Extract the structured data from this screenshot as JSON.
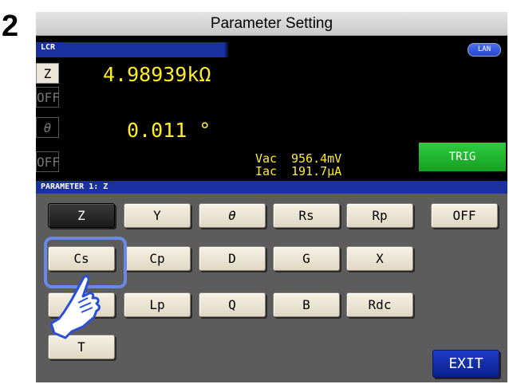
{
  "step_number": "2",
  "title": "Parameter Setting",
  "lcr_label": "LCR",
  "lan_label": "LAN",
  "rows": [
    {
      "param": "Z",
      "value": "4.98939kΩ"
    },
    {
      "param": "OFF"
    },
    {
      "param": "θ",
      "value": "0.011 °"
    },
    {
      "param": "OFF"
    }
  ],
  "monitor": {
    "vac_label": "Vac",
    "vac_value": "956.4mV",
    "iac_label": "Iac",
    "iac_value": "191.7μA"
  },
  "trig_label": "TRIG",
  "param_bar": "PARAMETER 1:  Z",
  "keys": {
    "row1": [
      "Z",
      "Y",
      "θ",
      "Rs",
      "Rp",
      "OFF"
    ],
    "row2": [
      "Cs",
      "Cp",
      "D",
      "G",
      "X"
    ],
    "row3": [
      "Lp",
      "Q",
      "B",
      "Rdc"
    ],
    "row4": [
      "T"
    ]
  },
  "exit_label": "EXIT",
  "colors": {
    "title_bar_bg": "#d0d0d0",
    "screen_bg": "#000000",
    "readout": "#ffee22",
    "trig": "#22b830",
    "param_bar": "#1a2fa0",
    "exit_key": "#1330b0",
    "highlight": "#6a88e8"
  },
  "icons": [
    "pointing-hand-icon"
  ]
}
